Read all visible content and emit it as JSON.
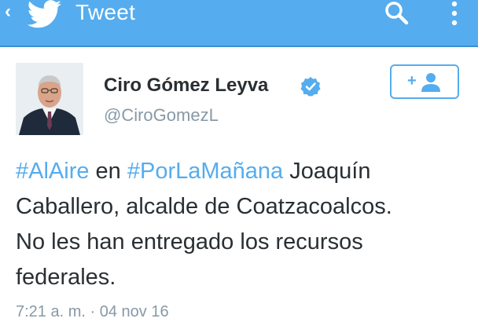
{
  "header": {
    "title": "Tweet",
    "back_icon": "chevron-left-icon",
    "logo_icon": "twitter-bird-icon",
    "search_icon": "search-icon",
    "menu_icon": "more-vertical-icon",
    "background_color": "#55acee"
  },
  "tweet": {
    "author_name": "Ciro Gómez Leyva",
    "author_handle": "@CiroGomezL",
    "verified": true,
    "follow_icon": "add-user-icon",
    "text_parts": {
      "hashtag_1": "#AlAire",
      "connector": " en ",
      "hashtag_2": "#PorLaMañana",
      "line_1_rest": " Joaquín",
      "line_2": "Caballero, alcalde de Coatzacoalcos.",
      "line_3": "No les han entregado los recursos",
      "line_4": "federales."
    },
    "timestamp": "7:21 a. m. · 04 nov 16"
  },
  "colors": {
    "link": "#55acee",
    "text": "#292f33",
    "secondary": "#8899a6"
  }
}
